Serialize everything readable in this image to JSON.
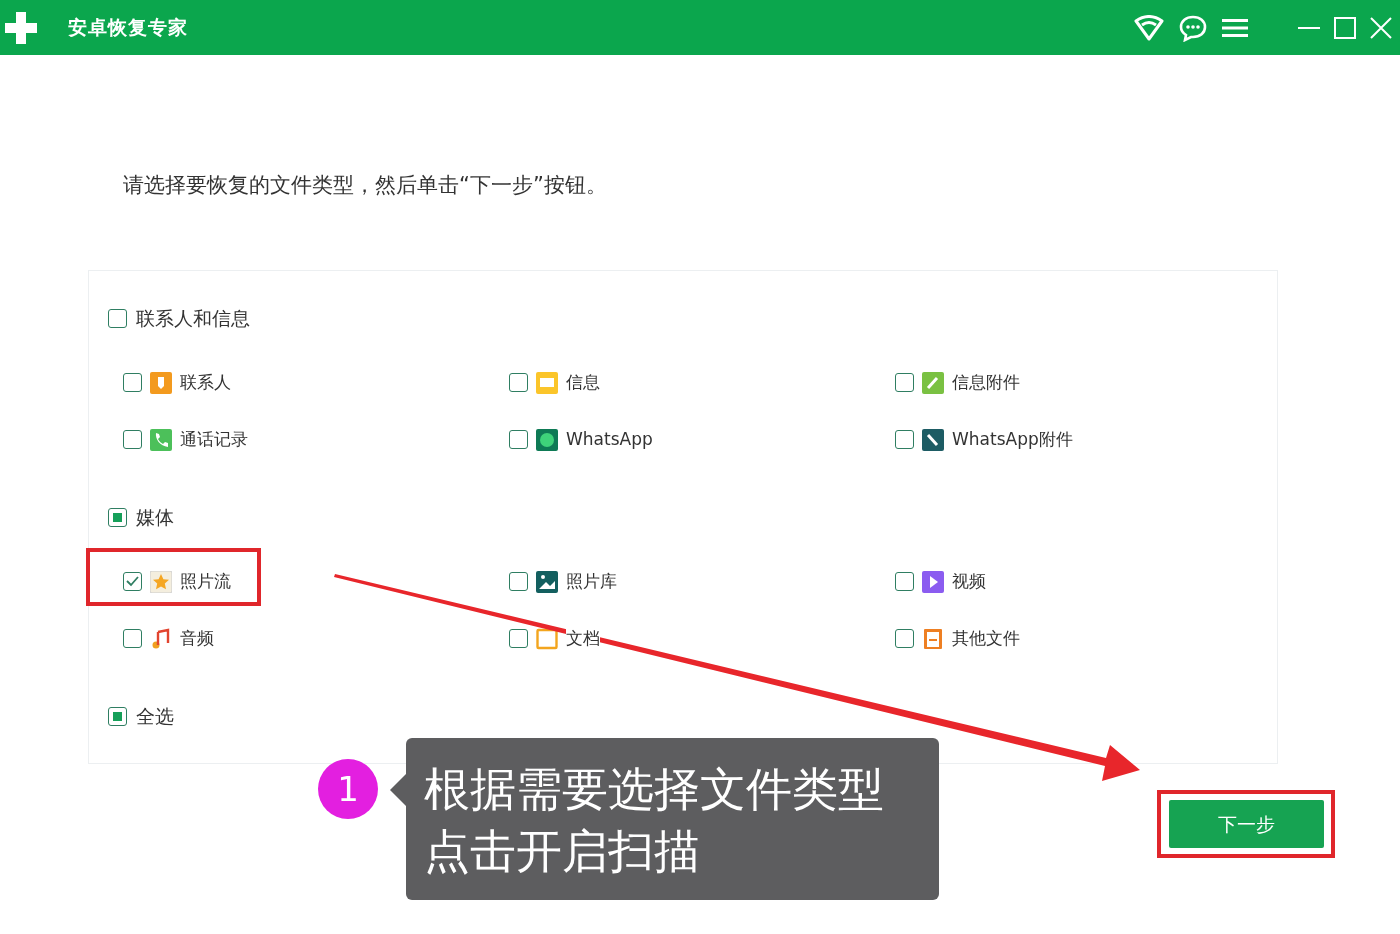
{
  "window": {
    "title": "安卓恢复专家"
  },
  "instruction": "请选择要恢复的文件类型，然后单击“下一步”按钮。",
  "groups": [
    {
      "label": "联系人和信息",
      "partial": false,
      "items": [
        {
          "label": "联系人",
          "checked": false,
          "highlighted": false
        },
        {
          "label": "信息",
          "checked": false,
          "highlighted": false
        },
        {
          "label": "信息附件",
          "checked": false,
          "highlighted": false
        },
        {
          "label": "通话记录",
          "checked": false,
          "highlighted": false
        },
        {
          "label": "WhatsApp",
          "checked": false,
          "highlighted": false
        },
        {
          "label": "WhatsApp附件",
          "checked": false,
          "highlighted": false
        }
      ]
    },
    {
      "label": "媒体",
      "partial": true,
      "items": [
        {
          "label": "照片流",
          "checked": true,
          "highlighted": true
        },
        {
          "label": "照片库",
          "checked": false,
          "highlighted": false
        },
        {
          "label": "视频",
          "checked": false,
          "highlighted": false
        },
        {
          "label": "音频",
          "checked": false,
          "highlighted": false
        },
        {
          "label": "文档",
          "checked": false,
          "highlighted": false
        },
        {
          "label": "其他文件",
          "checked": false,
          "highlighted": false
        }
      ]
    }
  ],
  "select_all": {
    "label": "全选",
    "partial": true
  },
  "next_button": {
    "label": "下一步",
    "highlighted": true
  },
  "callout": {
    "step": "1",
    "lines": [
      "根据需要选择文件类型",
      "点击开启扫描"
    ]
  }
}
